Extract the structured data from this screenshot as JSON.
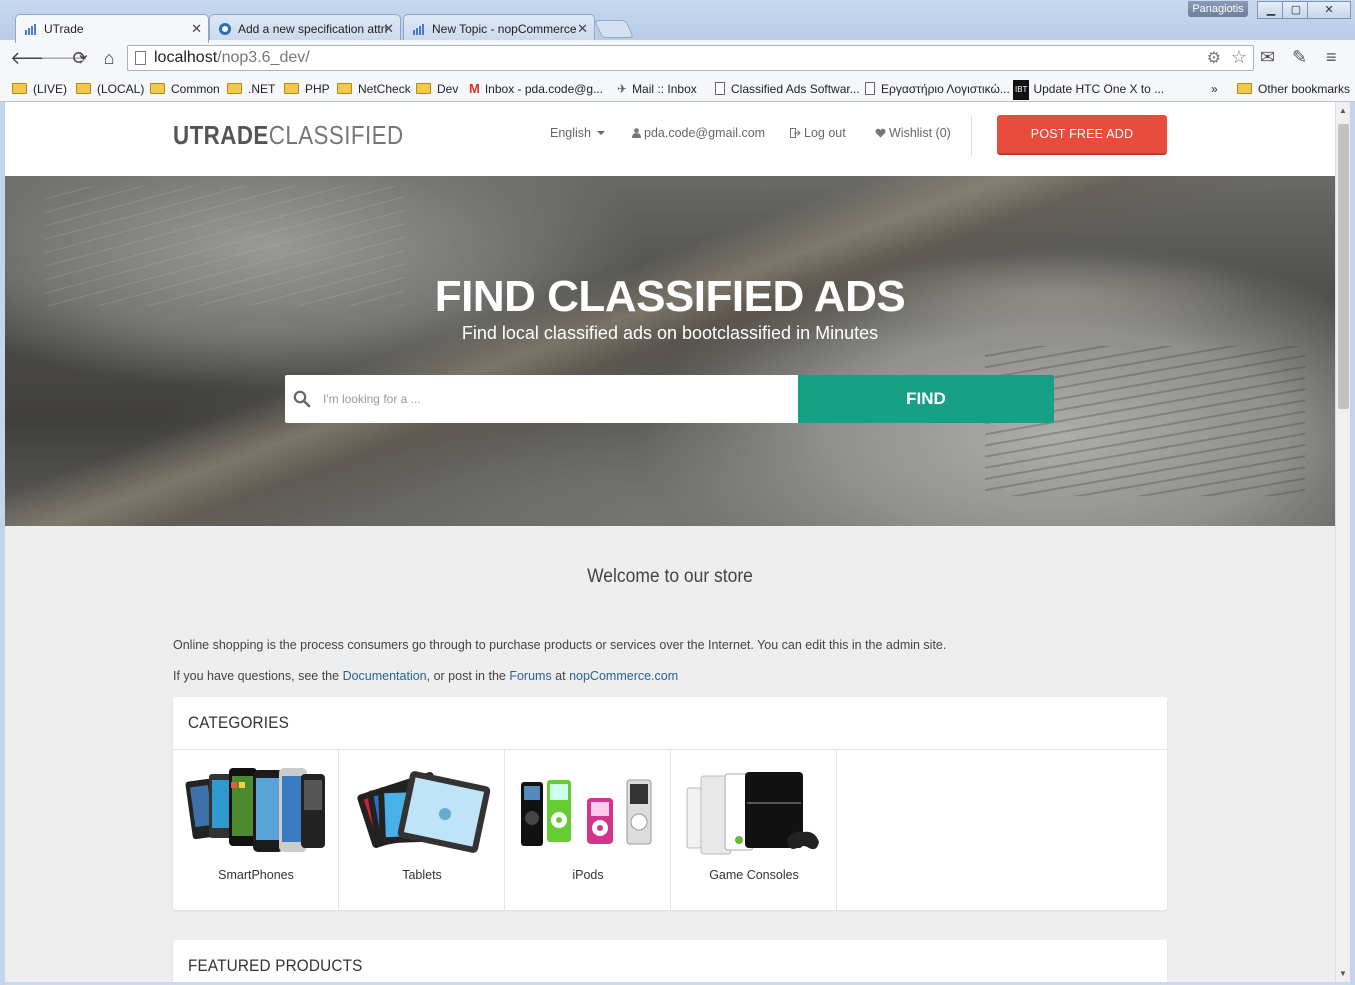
{
  "browser": {
    "tabs": [
      {
        "title": "UTrade"
      },
      {
        "title": "Add a new specification attri"
      },
      {
        "title": "New Topic - nopCommerce"
      }
    ],
    "user_badge": "Panagiotis",
    "url_host": "localhost",
    "url_path": "/nop3.6_dev/",
    "bookmarks": [
      "(LIVE)",
      "(LOCAL)",
      "Common",
      ".NET",
      "PHP",
      "NetCheck",
      "Dev",
      "Inbox - pda.code@g...",
      "Mail :: Inbox",
      "Classified Ads Softwar...",
      "Εργαστήριο Λογιστικώ...",
      "Update HTC One X to ..."
    ],
    "bookmarks_overflow": "»",
    "other_bookmarks": "Other bookmarks"
  },
  "header": {
    "logo_bold": "UTRADE",
    "logo_light": "CLASSIFIED",
    "language": "English",
    "account": "pda.code@gmail.com",
    "logout": "Log out",
    "wishlist": "Wishlist (0)",
    "post_button": "POST FREE ADD"
  },
  "hero": {
    "title": "FIND CLASSIFIED ADS",
    "subtitle": "Find local classified ads on bootclassified in Minutes",
    "search_placeholder": "I'm looking for a ...",
    "find_button": "FIND"
  },
  "welcome": {
    "title": "Welcome to our store",
    "paragraph1": "Online shopping is the process consumers go through to purchase products or services over the Internet. You can edit this in the admin site.",
    "p2_prefix": "If you have questions, see the ",
    "p2_link1": "Documentation",
    "p2_mid": ", or post in the ",
    "p2_link2": "Forums",
    "p2_at": " at ",
    "p2_link3": "nopCommerce.com"
  },
  "categories": {
    "title": "CATEGORIES",
    "items": [
      {
        "name": "SmartPhones"
      },
      {
        "name": "Tablets"
      },
      {
        "name": "iPods"
      },
      {
        "name": "Game Consoles"
      }
    ]
  },
  "featured": {
    "title": "FEATURED PRODUCTS"
  },
  "colors": {
    "post_button": "#e74c3c",
    "find_button": "#16a085",
    "link": "#2a6496"
  }
}
